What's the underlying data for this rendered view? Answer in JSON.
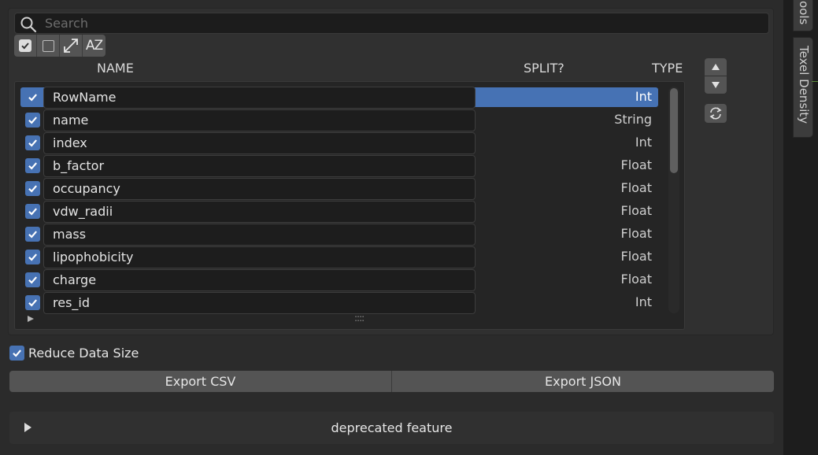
{
  "search": {
    "placeholder": "Search"
  },
  "columns": {
    "name": "NAME",
    "split": "SPLIT?",
    "type": "TYPE"
  },
  "toolbar": {
    "select_all_icon": "checkbox-checked-icon",
    "deselect_all_icon": "checkbox-empty-icon",
    "invert_icon": "invert-arrows-icon",
    "sort_icon": "sort-alpha-icon",
    "sort_label": "AZ"
  },
  "rows": [
    {
      "name": "RowName",
      "type": "Int",
      "checked": true,
      "selected": true
    },
    {
      "name": "name",
      "type": "String",
      "checked": true,
      "selected": false
    },
    {
      "name": "index",
      "type": "Int",
      "checked": true,
      "selected": false
    },
    {
      "name": "b_factor",
      "type": "Float",
      "checked": true,
      "selected": false
    },
    {
      "name": "occupancy",
      "type": "Float",
      "checked": true,
      "selected": false
    },
    {
      "name": "vdw_radii",
      "type": "Float",
      "checked": true,
      "selected": false
    },
    {
      "name": "mass",
      "type": "Float",
      "checked": true,
      "selected": false
    },
    {
      "name": "lipophobicity",
      "type": "Float",
      "checked": true,
      "selected": false
    },
    {
      "name": "charge",
      "type": "Float",
      "checked": true,
      "selected": false
    },
    {
      "name": "res_id",
      "type": "Int",
      "checked": true,
      "selected": false
    }
  ],
  "options": {
    "reduce_data_size": "Reduce Data Size",
    "reduce_checked": true
  },
  "buttons": {
    "export_csv": "Export CSV",
    "export_json": "Export JSON"
  },
  "deprecated": {
    "label": "deprecated feature"
  },
  "right_tabs": [
    {
      "label": "ools"
    },
    {
      "label": "Texel Density"
    }
  ],
  "colors": {
    "accent": "#4772b3",
    "panel": "#2b2b2b",
    "field": "#1d1d1d"
  }
}
